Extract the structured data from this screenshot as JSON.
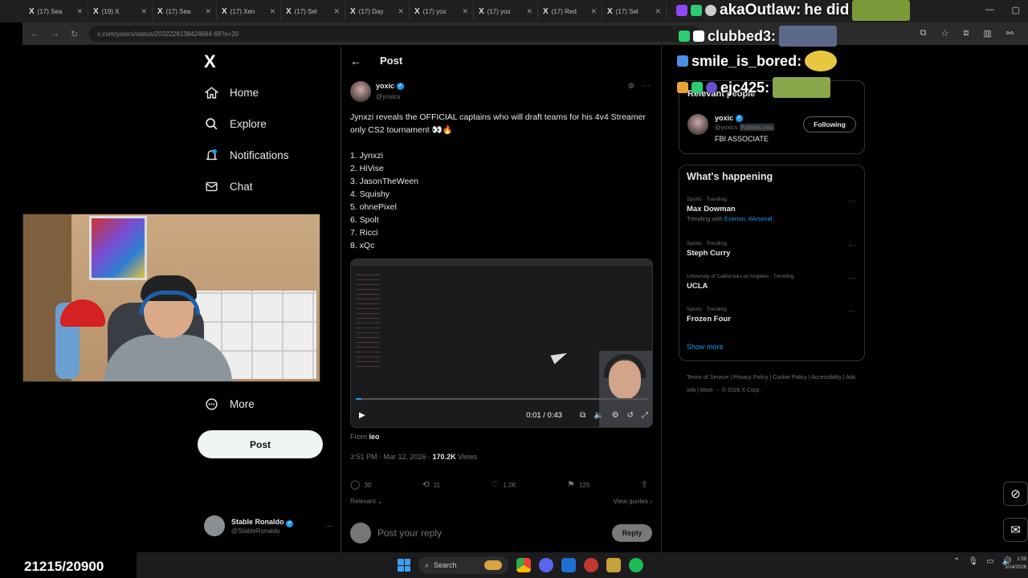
{
  "browser": {
    "tabs": [
      "(17) Sea",
      "(19) X",
      "(17) Sea",
      "(17) Xen",
      "(17) Sel",
      "(17) Day",
      "(17) yox",
      "(17) yox",
      "(17) Red",
      "(17) Sel"
    ],
    "url": "x.com/yoxics/status/2032228138424664 69?s=20"
  },
  "sidebar": {
    "logo": "X",
    "items": [
      {
        "label": "Home",
        "icon": "home-icon"
      },
      {
        "label": "Explore",
        "icon": "search-icon"
      },
      {
        "label": "Notifications",
        "icon": "bell-icon"
      },
      {
        "label": "Chat",
        "icon": "mail-icon"
      },
      {
        "label": "More",
        "icon": "more-icon"
      }
    ],
    "post_button": "Post",
    "account": {
      "name": "Stable Ronaldo",
      "handle": "@StableRonaldo"
    }
  },
  "post": {
    "header": "Post",
    "author_name": "yoxic",
    "author_handle": "@yoxics",
    "text": "Jynxzi reveals the OFFICIAL captains who will draft teams for his 4v4 Streamer only CS2 tournament 👀🔥",
    "list": [
      "1. Jynxzi",
      "2. HiVise",
      "3. JasonTheWeen",
      "4. Squishy",
      "5. ohnePixel",
      "6. Spolt",
      "7. Ricci",
      "8. xQc"
    ],
    "video": {
      "time": "0:01 / 0:43",
      "progress": 0.02
    },
    "from_label": "From",
    "from_user": "leo",
    "timestamp": "3:51 PM · Mar 12, 2026 · ",
    "views_count": "170.2K",
    "views_label": " Views",
    "counts": {
      "replies": "30",
      "reposts": "11",
      "likes": "1.2K",
      "bookmarks": "125"
    },
    "relevant_label": "Relevant ⌄",
    "view_quotes": "View quotes ›",
    "reply_placeholder": "Post your reply",
    "reply_button": "Reply"
  },
  "right": {
    "relevant_title": "Relevant people",
    "person": {
      "name": "yoxic",
      "handle": "@yoxics",
      "follows": "Follows you",
      "bio": "FBI ASSOCIATE",
      "button": "Following"
    },
    "happening_title": "What's happening",
    "trends": [
      {
        "category": "Sports · Trending",
        "topic": "Max Dowman",
        "with_prefix": "Trending with ",
        "with_links": "Everton, #Arsenal"
      },
      {
        "category": "Sports · Trending",
        "topic": "Steph Curry",
        "with_prefix": "",
        "with_links": ""
      },
      {
        "category": "University of California Los Angeles · Trending",
        "topic": "UCLA",
        "with_prefix": "",
        "with_links": ""
      },
      {
        "category": "Sports · Trending",
        "topic": "Frozen Four",
        "with_prefix": "",
        "with_links": ""
      }
    ],
    "show_more": "Show more",
    "footer": "Terms of Service  |  Privacy Policy  |  Cookie Policy  |  Accessibility  |  Ads info  |  More ···  © 2026 X Corp."
  },
  "chat": [
    {
      "user": "akaOutlaw",
      "message": " he did"
    },
    {
      "user": "clubbed3",
      "message": ""
    },
    {
      "user": "smile_is_bored",
      "message": ""
    },
    {
      "user": "ejc425",
      "message": ""
    }
  ],
  "overlay": {
    "counter": "21215/20900"
  },
  "taskbar": {
    "search": "Search",
    "clock_time": "1:59",
    "clock_date": "3/14/2026"
  },
  "colors": {
    "accent": "#1d9bf0",
    "background": "#000000",
    "text": "#e7e9ea",
    "muted": "#71767b"
  }
}
